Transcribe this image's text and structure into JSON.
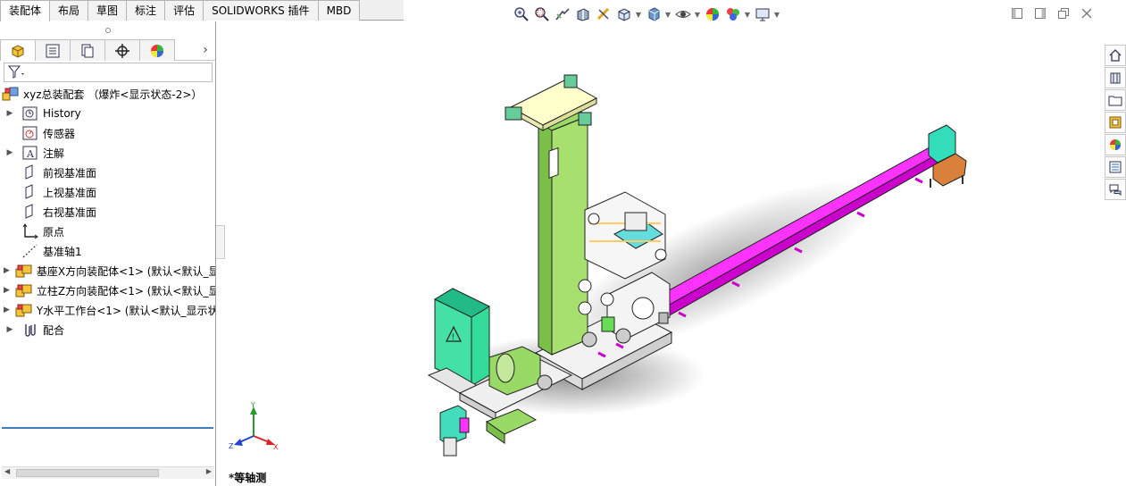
{
  "command_tabs": [
    "装配体",
    "布局",
    "草图",
    "标注",
    "评估",
    "SOLIDWORKS 插件",
    "MBD"
  ],
  "active_tab": "装配体",
  "hud_icons": [
    "zoom-to-fit-icon",
    "zoom-to-area-icon",
    "previous-view-icon",
    "section-view-icon",
    "dynamic-annotation-icon",
    "view-orientation-icon",
    "display-style-icon",
    "hide-show-items-icon",
    "edit-appearance-icon",
    "apply-scene-icon",
    "view-settings-icon"
  ],
  "feature_tree": {
    "root": "xyz总装配套 （爆炸<显示状态-2>）",
    "items": [
      {
        "label": "History",
        "caret": true,
        "icon": "history-icon"
      },
      {
        "label": "传感器",
        "caret": false,
        "icon": "sensor-icon"
      },
      {
        "label": "注解",
        "caret": true,
        "icon": "annotation-icon"
      },
      {
        "label": "前视基准面",
        "caret": false,
        "icon": "plane-icon"
      },
      {
        "label": "上视基准面",
        "caret": false,
        "icon": "plane-icon"
      },
      {
        "label": "右视基准面",
        "caret": false,
        "icon": "plane-icon"
      },
      {
        "label": "原点",
        "caret": false,
        "icon": "origin-icon"
      },
      {
        "label": "基准轴1",
        "caret": false,
        "icon": "axis-icon"
      },
      {
        "label": "基座X方向装配体<1> (默认<默认_显",
        "caret": true,
        "icon": "subassembly-icon"
      },
      {
        "label": "立柱Z方向装配体<1> (默认<默认_显",
        "caret": true,
        "icon": "subassembly-icon"
      },
      {
        "label": "Y水平工作台<1> (默认<默认_显示状",
        "caret": true,
        "icon": "subassembly-icon"
      },
      {
        "label": "配合",
        "caret": true,
        "icon": "mates-icon"
      }
    ]
  },
  "triad": {
    "x": "X",
    "y": "Y",
    "z": "Z"
  },
  "view_name": "*等轴测",
  "colors": {
    "beam": "#ff33ff",
    "column": "#99d966",
    "cabinet": "#33dd99",
    "top_plate": "#ffffcc"
  }
}
